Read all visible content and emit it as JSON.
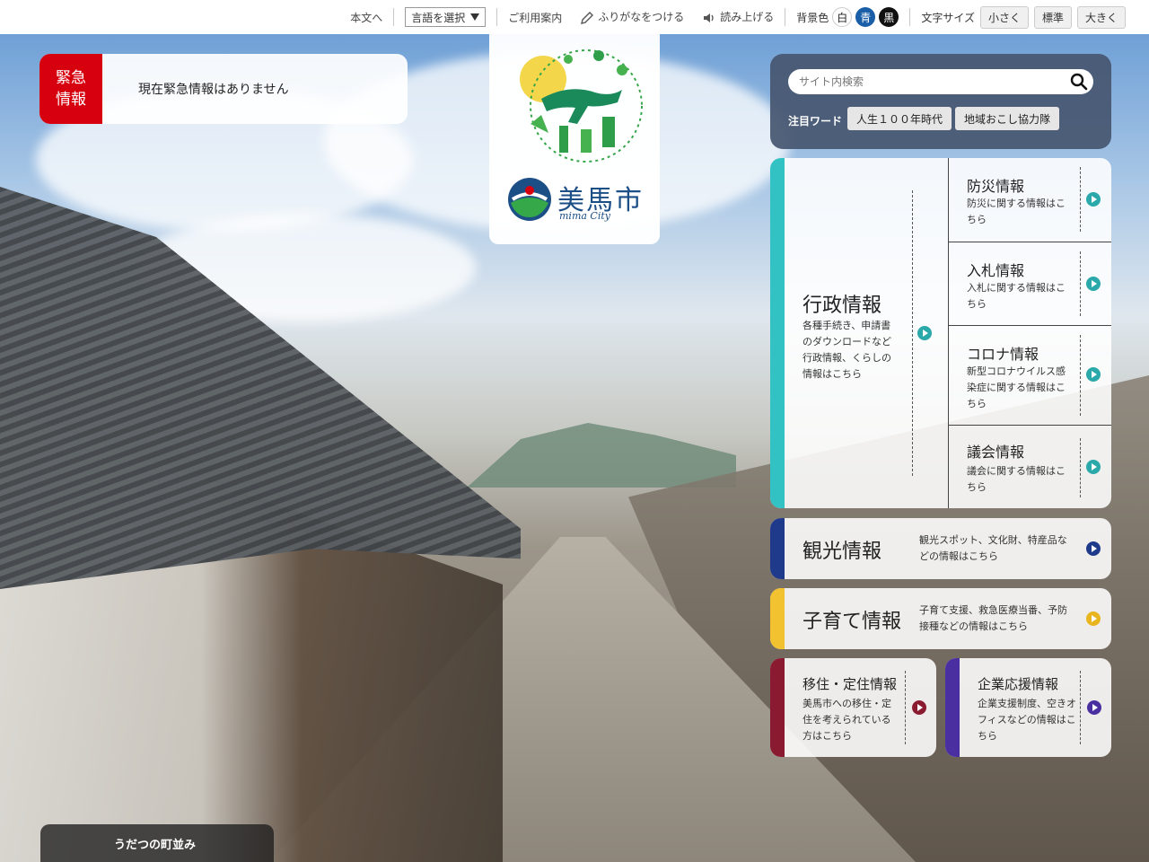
{
  "topbar": {
    "skip_link": "本文へ",
    "language": "言語を選択",
    "guide": "ご利用案内",
    "furigana": "ふりがなをつける",
    "read_aloud": "読み上げる",
    "bg_color_label": "背景色",
    "bg_colors": [
      "白",
      "青",
      "黒"
    ],
    "font_size_label": "文字サイズ",
    "font_sizes": [
      "小さく",
      "標準",
      "大きく"
    ]
  },
  "emergency": {
    "tag": "緊急\n情報",
    "message": "現在緊急情報はありません"
  },
  "logo": {
    "city_name": "美馬市",
    "city_roman": "mima City"
  },
  "search": {
    "placeholder": "サイト内検索",
    "keywords_label": "注目ワード",
    "keywords": [
      "人生１００年時代",
      "地域おこし協力隊"
    ]
  },
  "categories": {
    "admin": {
      "title": "行政情報",
      "desc": "各種手続き、申請書のダウンロードなど行政情報、くらしの情報はこちら",
      "accent": "#33c2c4",
      "subs": [
        {
          "title": "防災情報",
          "desc": "防災に関する情報はこちら"
        },
        {
          "title": "入札情報",
          "desc": "入札に関する情報はこちら"
        },
        {
          "title": "コロナ情報",
          "desc": "新型コロナウイルス感染症に関する情報はこちら"
        },
        {
          "title": "議会情報",
          "desc": "議会に関する情報はこちら"
        }
      ]
    },
    "tourism": {
      "title": "観光情報",
      "desc": "観光スポット、文化財、特産品などの情報はこちら",
      "accent": "#1f3a8a"
    },
    "childcare": {
      "title": "子育て情報",
      "desc": "子育て支援、救急医療当番、予防接種などの情報はこちら",
      "accent": "#f2c230"
    },
    "migration": {
      "title": "移住・定住情報",
      "desc": "美馬市への移住・定住を考えられている方はこちら",
      "accent": "#8a1a30"
    },
    "business": {
      "title": "企業応援情報",
      "desc": "企業支援制度、空きオフィスなどの情報はこちら",
      "accent": "#4a2fa0"
    }
  },
  "caption": "うだつの町並み"
}
